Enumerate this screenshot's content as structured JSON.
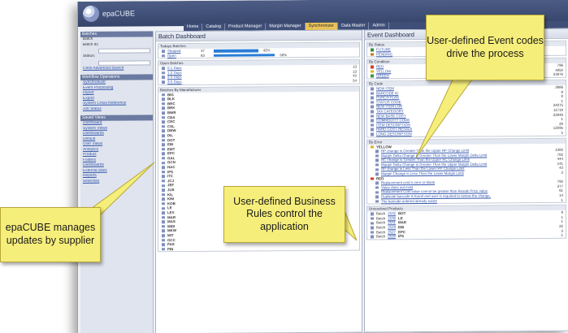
{
  "app": {
    "logo_text": "epaCUBE"
  },
  "nav": {
    "tabs": [
      "Home",
      "Catalog",
      "Product Manager",
      "Margin Manager",
      "Synchronizer",
      "Data Master",
      "Admin"
    ],
    "active_index": 4
  },
  "sidebar": {
    "sections": [
      {
        "title": "Batches",
        "lines": [
          {
            "text": "Batch",
            "kind": "label"
          },
          {
            "text": "Batch ID:",
            "kind": "label"
          },
          {
            "text": "Status:",
            "kind": "label"
          },
          {
            "text": "Clear     Advanced Search",
            "kind": "link"
          }
        ]
      },
      {
        "title": "Workflow Operations",
        "lines": [
          {
            "text": "Synchronizer",
            "kind": "link"
          },
          {
            "text": "Event Processing",
            "kind": "link"
          },
          {
            "text": "Import",
            "kind": "link"
          },
          {
            "text": "Export",
            "kind": "link"
          },
          {
            "text": "System Cross Reference",
            "kind": "link"
          },
          {
            "text": "Job Status",
            "kind": "link"
          }
        ]
      },
      {
        "title": "Saved Views",
        "lines": [
          {
            "text": "Dashboard",
            "kind": "link"
          },
          {
            "text": "System Views",
            "kind": "link"
          },
          {
            "text": "Dashboards",
            "kind": "link"
          },
          {
            "text": "Default",
            "kind": "link"
          },
          {
            "text": "User Views",
            "kind": "link"
          },
          {
            "text": "Analytics",
            "kind": "link"
          },
          {
            "text": "Product",
            "kind": "link"
          },
          {
            "text": "Folders",
            "kind": "link"
          },
          {
            "text": "Dashboards",
            "kind": "link"
          },
          {
            "text": "External Sites",
            "kind": "link"
          },
          {
            "text": "Reports",
            "kind": "link"
          },
          {
            "text": "Searches",
            "kind": "link"
          }
        ]
      }
    ]
  },
  "batch_dashboard": {
    "title": "Batch Dashboard",
    "todays_batches": {
      "head": "Todays Batches",
      "rows": [
        {
          "label": "Stepped",
          "count": "37",
          "pct_text": "42%",
          "pct": 0.42
        },
        {
          "label": "Open",
          "count": "83",
          "pct_text": "58%",
          "pct": 0.58
        }
      ]
    },
    "open_batches": {
      "head": "Open Batches",
      "rows": [
        {
          "label": "0-1 Days",
          "count": "13"
        },
        {
          "label": "1-2 Days",
          "count": "13"
        },
        {
          "label": "2-3 Days",
          "count": "43"
        },
        {
          "label": "3-5 Days",
          "count": "54"
        }
      ]
    },
    "by_manufacturer": {
      "head": "Batches By Manufacturer",
      "rows": [
        "BIG",
        "BLK",
        "BRC",
        "BRK",
        "BWR",
        "CBA",
        "CRC",
        "CSL",
        "DBW",
        "DIL",
        "DOT",
        "EBI",
        "EMT",
        "EPC",
        "GAL",
        "GCN",
        "HAC",
        "IPS",
        "ITC",
        "JCJ",
        "JEF",
        "JUS",
        "KIL",
        "KIM",
        "KOB",
        "LE",
        "LEV",
        "MAR",
        "MAS",
        "MIDI",
        "MKW",
        "MIT",
        "OCC",
        "PAS",
        "PIN"
      ]
    }
  },
  "event_dashboard": {
    "title": "Event Dashboard",
    "by_status": {
      "head": "By Status",
      "rows": [
        {
          "label": "FUTURE",
          "count": ""
        },
        {
          "label": "PENDING",
          "count": ""
        }
      ]
    },
    "by_condition": {
      "head": "By Condition",
      "rows": [
        {
          "label": "RED",
          "count": "796"
        },
        {
          "label": "YELLOW",
          "count": "4850"
        },
        {
          "label": "GREEN",
          "count": "53876"
        }
      ]
    },
    "by_code": {
      "head": "By Code",
      "rows": [
        {
          "label": "NEW ITEM",
          "count": "3986"
        },
        {
          "label": "BARCODE ID",
          "count": "8"
        },
        {
          "label": "PURCH FLAG",
          "count": "8"
        },
        {
          "label": "STATUS CODE",
          "count": "1"
        },
        {
          "label": "NEW ITEM LOR",
          "count": "34075"
        },
        {
          "label": "TAX CATEGORY",
          "count": "11718"
        },
        {
          "label": "NEW BASE COST",
          "count": "22846"
        },
        {
          "label": "COMMODITY CODE",
          "count": "1"
        },
        {
          "label": "ITEM DESCRIPTION",
          "count": "28"
        },
        {
          "label": "HARD COST RESALE",
          "count": "12095"
        },
        {
          "label": "LONG DESCRIPTION",
          "count": "5"
        }
      ]
    },
    "by_error": {
      "head": "By Error",
      "yellow_label": "YELLOW",
      "yellow_rows": [
        {
          "label": "RP change is Greater Than the Upper RP Change Limit",
          "count": "1382"
        },
        {
          "label": "Margin Delta Change is Greater Than the Lower Margin Delta Limit",
          "count": "782"
        },
        {
          "label": "RC change is Greater Than the Upper RC Change Limit",
          "count": "444"
        },
        {
          "label": "Margin Delta Change is Greater Than the Upper Margin Delta Limit",
          "count": "141"
        },
        {
          "label": "RP change is Less Than the Lower RP Change Limit",
          "count": "43"
        },
        {
          "label": "Margin Change is Less Than the Lower Margin Limit",
          "count": "2"
        }
      ],
      "red_label": "RED",
      "red_rows": [
        {
          "label": "Replacement cost is zero or blank",
          "count": "792"
        },
        {
          "label": "Value does not exist",
          "count": "377"
        },
        {
          "label": "Replacement Cost value cannot be greater than Resale Price value",
          "count": "61"
        },
        {
          "label": "Duplicate barcode is found and user is required to review the change.",
          "count": "14"
        },
        {
          "label": "The barcode entered already exists",
          "count": "1"
        }
      ]
    },
    "unresolved": {
      "head": "Unresolved Products",
      "rows": [
        {
          "label": "Batch",
          "id": "2532",
          "code": "BOT",
          "count": "9"
        },
        {
          "label": "Batch",
          "id": "2536",
          "code": "LE",
          "count": "1"
        },
        {
          "label": "Batch",
          "id": "2531",
          "code": "MAR",
          "count": "1"
        },
        {
          "label": "Batch",
          "id": "2529",
          "code": "EBI",
          "count": "22"
        },
        {
          "label": "Batch",
          "id": "2527",
          "code": "EPC",
          "count": "3"
        },
        {
          "label": "Batch",
          "id": "2526",
          "code": "IPS",
          "count": "1"
        }
      ]
    }
  },
  "callouts": {
    "event_codes": "User-defined Event codes drive the process",
    "business_rules": "User-defined Business Rules control the application",
    "supplier": "epaCUBE manages updates by supplier"
  },
  "colors": {
    "callout_fill": "#f6ee7a",
    "bar_blue": "#2a7dd6",
    "header_navy": "#3f4f78"
  }
}
